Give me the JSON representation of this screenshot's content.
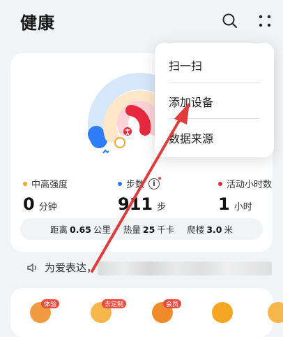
{
  "header": {
    "title": "健康"
  },
  "metrics": [
    {
      "label": "中高强度",
      "value": "0",
      "unit": "分钟",
      "color": "#f5a623"
    },
    {
      "label": "步数",
      "value": "911",
      "unit": "步",
      "color": "#2f7df6"
    },
    {
      "label": "活动小时数",
      "value": "1",
      "unit": "小时",
      "color": "#e8283f"
    }
  ],
  "stats": {
    "distance_label": "距离",
    "distance_value": "0.65",
    "distance_unit": "公里",
    "calories_label": "热量",
    "calories_value": "25",
    "calories_unit": "千卡",
    "floors_label": "爬楼",
    "floors_value": "3.0",
    "floors_unit": "米"
  },
  "voice": {
    "text": "为爱表达，"
  },
  "services": [
    {
      "badge": "体验"
    },
    {
      "badge": "去定制"
    },
    {
      "badge": "会员"
    }
  ],
  "menu": {
    "items": [
      "扫一扫",
      "添加设备",
      "数据来源"
    ]
  },
  "colors": {
    "blue": "#2f7df6",
    "orange": "#f5a623",
    "red": "#e8283f",
    "annotation": "#e23b3b"
  },
  "icons": [
    "search-icon",
    "more-icon",
    "info-icon",
    "speaker-icon"
  ]
}
